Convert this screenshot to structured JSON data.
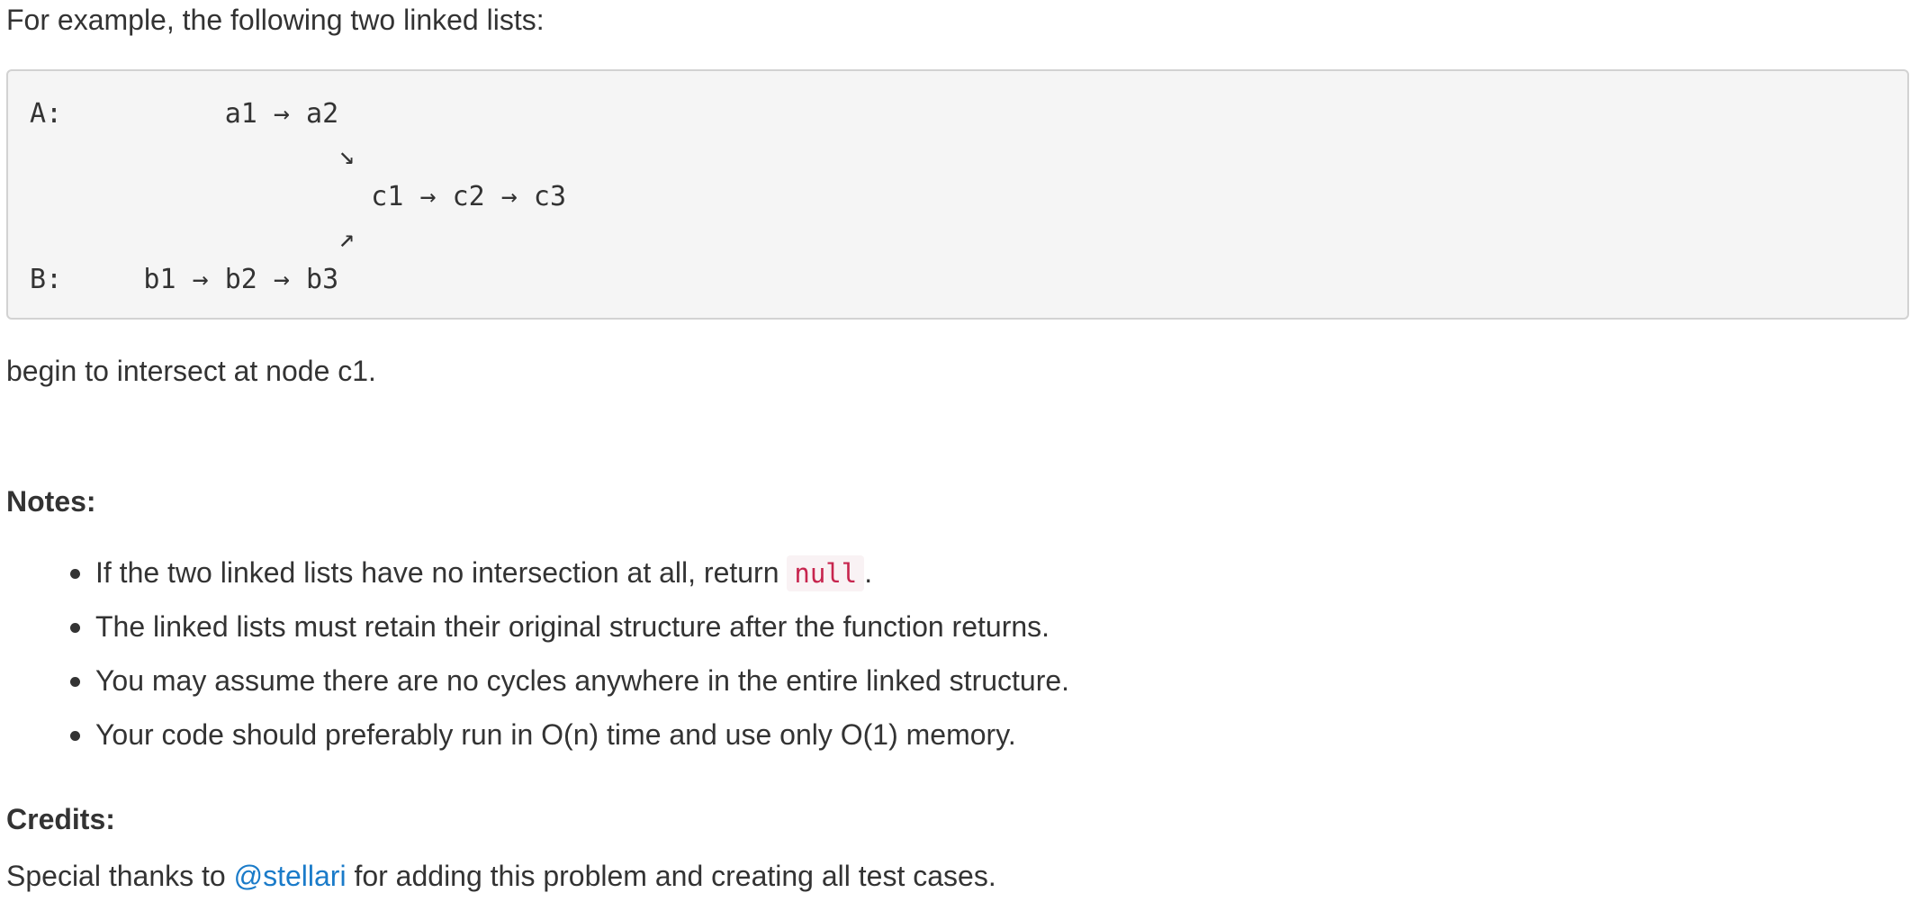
{
  "intro_text": "For example, the following two linked lists:",
  "code_block": {
    "line_a": "A:          a1 → a2",
    "arrow_down": "                   ↘",
    "line_c": "                     c1 → c2 → c3",
    "arrow_up": "                   ↗",
    "line_b": "B:     b1 → b2 → b3"
  },
  "after_text": "begin to intersect at node c1.",
  "notes": {
    "heading": "Notes:",
    "items": [
      {
        "before": "If the two linked lists have no intersection at all, return ",
        "code": "null",
        "after": "."
      },
      {
        "text": "The linked lists must retain their original structure after the function returns."
      },
      {
        "text": "You may assume there are no cycles anywhere in the entire linked structure."
      },
      {
        "text": "Your code should preferably run in O(n) time and use only O(1) memory."
      }
    ]
  },
  "credits": {
    "heading": "Credits:",
    "prefix": "Special thanks to ",
    "link_text": "@stellari",
    "suffix": " for adding this problem and creating all test cases."
  },
  "colors": {
    "text": "#333333",
    "link": "#1a7bc9",
    "inline_code": "#c7254e",
    "inline_code_bg": "#f9f2f4",
    "code_block_bg": "#f5f5f5",
    "code_block_border": "#d2d2d2"
  }
}
